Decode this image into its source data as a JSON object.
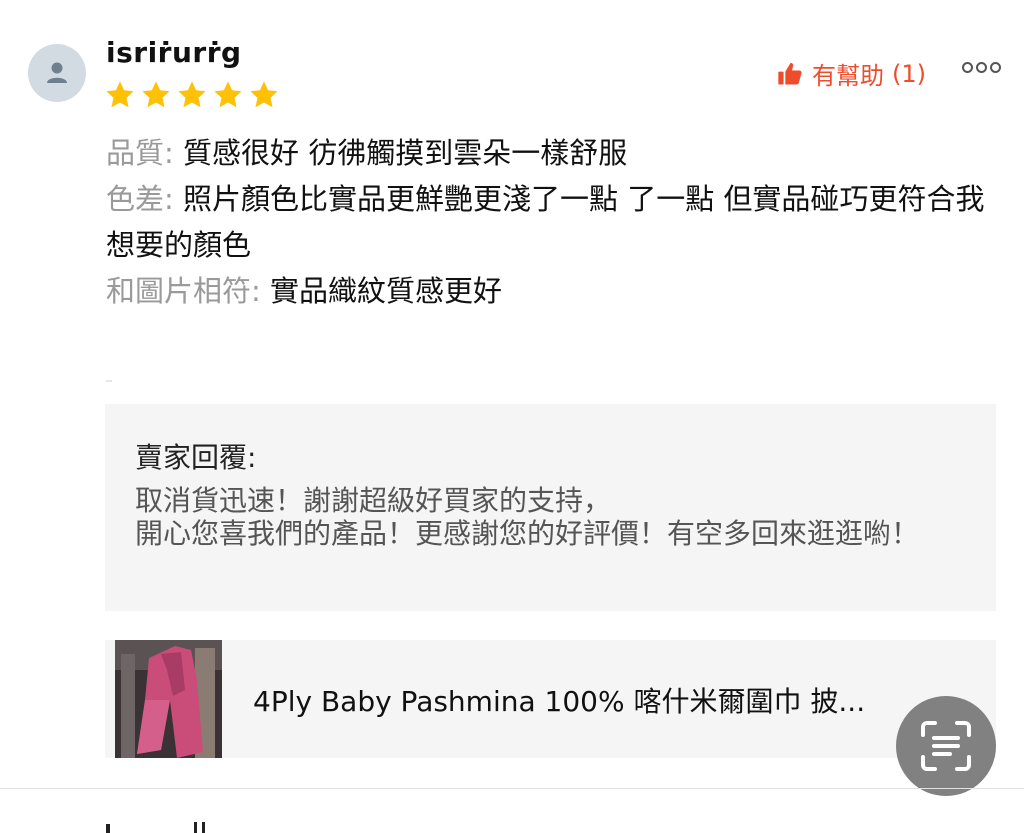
{
  "review": {
    "username": "isriṙurṙg",
    "rating": 5,
    "max_rating": 5,
    "helpful_label": "有幫助",
    "helpful_count_text": "(1)",
    "lines": [
      {
        "label": "品質: ",
        "text": "質感很好 彷彿觸摸到雲朵一樣舒服"
      },
      {
        "label": "色差: ",
        "text": "照片顏色比實品更鮮艷更淺了一點 了一點 但實品碰巧更符合我想要的顏色"
      },
      {
        "label": "和圖片相符: ",
        "text": "實品織紋質感更好"
      }
    ]
  },
  "seller_reply": {
    "title": "賣家回覆:",
    "text_lines": [
      "取消貨迅速！謝謝超級好買家的支持，",
      "開心您喜我們的產品！更感謝您的好評價！有空多回來逛逛喲！"
    ]
  },
  "product": {
    "name": "4Ply Baby Pashmina 100% 喀什米爾圍巾 披..."
  },
  "colors": {
    "accent": "#ee4d2d",
    "star": "#ffc107",
    "label_gray": "#9a9a9a",
    "reply_bg": "#f5f5f5"
  },
  "icons": {
    "avatar": "user-avatar-icon",
    "helpful": "thumbs-up-icon",
    "more": "more-options-icon",
    "scan": "text-scan-icon"
  }
}
